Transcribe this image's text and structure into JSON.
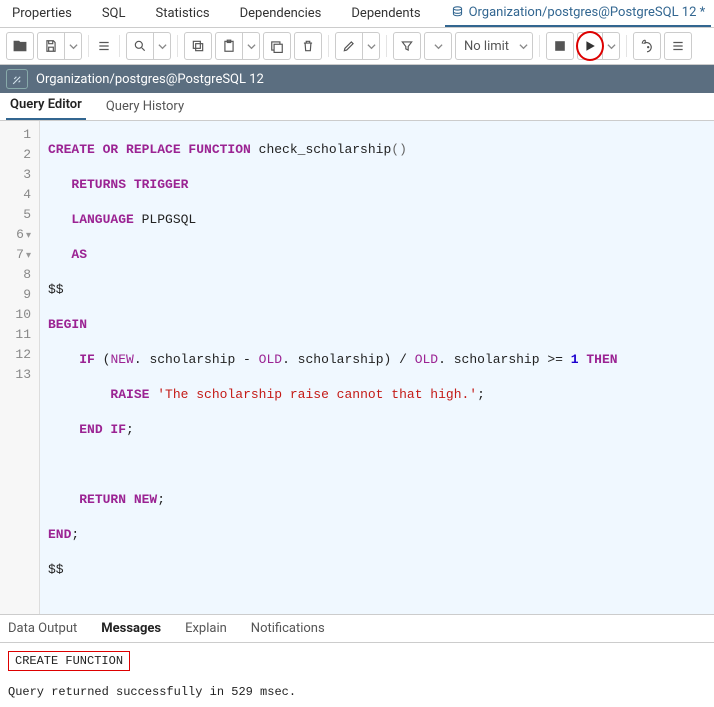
{
  "topTabs": {
    "t0": "Properties",
    "t1": "SQL",
    "t2": "Statistics",
    "t3": "Dependencies",
    "t4": "Dependents",
    "active": "Organization/postgres@PostgreSQL 12 *"
  },
  "toolbar": {
    "limit": "No limit"
  },
  "connection": {
    "label": "Organization/postgres@PostgreSQL 12"
  },
  "midTabs": {
    "editor": "Query Editor",
    "history": "Query History"
  },
  "code": {
    "l1a": "CREATE OR REPLACE FUNCTION",
    "l1b": " check_scholarship",
    "l1c": "()",
    "l2a": "RETURNS TRIGGER",
    "l3a": "LANGUAGE",
    "l3b": " PLPGSQL",
    "l4a": "AS",
    "l5": "$$",
    "l6": "BEGIN",
    "l7a": "IF",
    "l7b": " (",
    "l7c": "NEW",
    "l7d": ". scholarship - ",
    "l7e": "OLD",
    "l7f": ". scholarship) / ",
    "l7g": "OLD",
    "l7h": ". scholarship >= ",
    "l7i": "1",
    "l7j": "THEN",
    "l8a": "RAISE",
    "l8b": "'The scholarship raise cannot that high.'",
    "l8c": ";",
    "l9a": "END IF",
    "l9b": ";",
    "l11a": "RETURN NEW",
    "l11b": ";",
    "l12a": "END",
    "l12b": ";",
    "l13": "$$"
  },
  "bottomTabs": {
    "out": "Data Output",
    "msg": "Messages",
    "exp": "Explain",
    "not": "Notifications"
  },
  "messages": {
    "result": "CREATE FUNCTION",
    "status": "Query returned successfully in 529 msec."
  }
}
